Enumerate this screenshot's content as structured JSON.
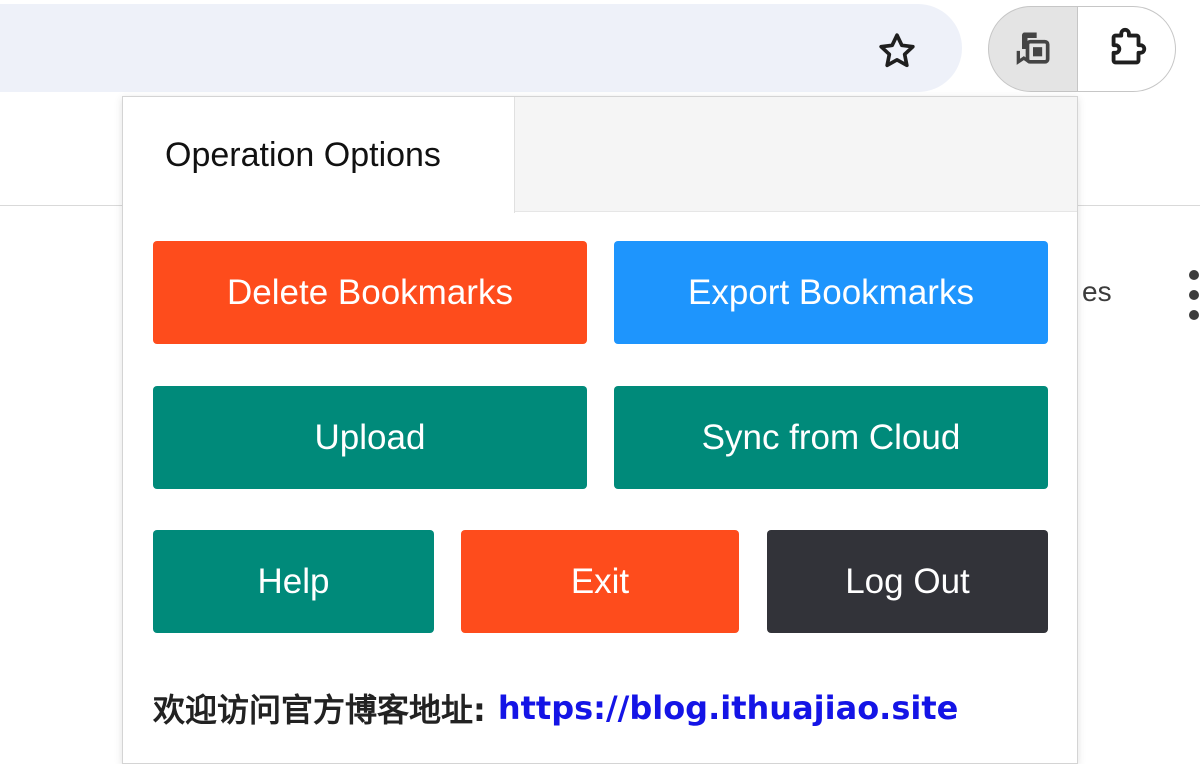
{
  "toolbar": {
    "bookmark_star_icon": "star-outline-icon",
    "active_extension_icon": "bookmark-sync-extension-icon",
    "extensions_icon": "puzzle-piece-icon"
  },
  "background": {
    "partial_text": "es"
  },
  "popup": {
    "tabs": [
      {
        "label": "Operation Options"
      }
    ],
    "buttons": {
      "delete": {
        "label": "Delete Bookmarks",
        "color": "#fe4c1c"
      },
      "export": {
        "label": "Export Bookmarks",
        "color": "#1e95fd"
      },
      "upload": {
        "label": "Upload",
        "color": "#008a7a"
      },
      "sync": {
        "label": "Sync from Cloud",
        "color": "#008a7a"
      },
      "help": {
        "label": "Help",
        "color": "#008a7a"
      },
      "exit": {
        "label": "Exit",
        "color": "#fe4c1c"
      },
      "logout": {
        "label": "Log Out",
        "color": "#323339"
      }
    },
    "footer": {
      "text": "欢迎访问官方博客地址:",
      "link": "https://blog.ithuajiao.site"
    }
  }
}
